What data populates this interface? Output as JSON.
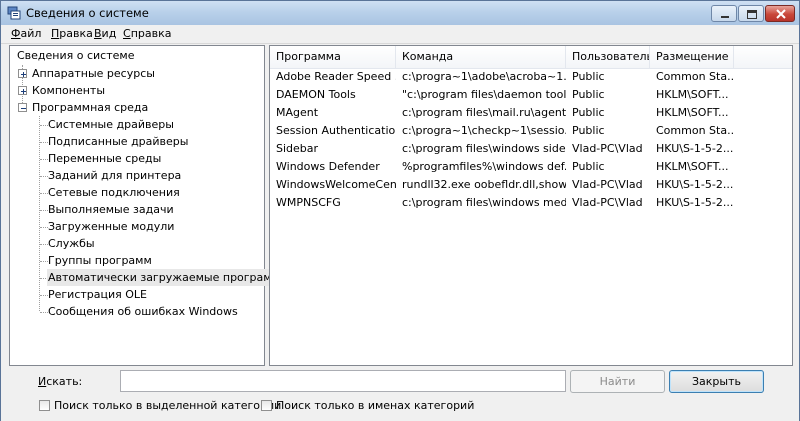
{
  "window": {
    "title": "Сведения о системе"
  },
  "menu": [
    "Файл",
    "Правка",
    "Вид",
    "Справка"
  ],
  "tree": {
    "root": "Сведения о системе",
    "nodes": [
      {
        "label": "Аппаратные ресурсы",
        "expander": "+"
      },
      {
        "label": "Компоненты",
        "expander": "+"
      },
      {
        "label": "Программная среда",
        "expander": "−"
      }
    ],
    "software_children": [
      "Системные драйверы",
      "Подписанные драйверы",
      "Переменные среды",
      "Заданий для принтера",
      "Сетевые подключения",
      "Выполняемые задачи",
      "Загруженные модули",
      "Службы",
      "Группы программ",
      "Автоматически загружаемые программы",
      "Регистрация OLE",
      "Сообщения об ошибках Windows"
    ],
    "selected": "Автоматически загружаемые программы"
  },
  "table": {
    "columns": [
      "Программа",
      "Команда",
      "Пользователь",
      "Размещение"
    ],
    "rows": [
      [
        "Adobe Reader Speed ...",
        "c:\\progra~1\\adobe\\acroba~1....",
        "Public",
        "Common Sta..."
      ],
      [
        "DAEMON Tools",
        "\"c:\\program files\\daemon tool...",
        "Public",
        "HKLM\\SOFT..."
      ],
      [
        "MAgent",
        "c:\\program files\\mail.ru\\agent...",
        "Public",
        "HKLM\\SOFT..."
      ],
      [
        "Session Authentication...",
        "c:\\progra~1\\checkp~1\\sessio...",
        "Public",
        "Common Sta..."
      ],
      [
        "Sidebar",
        "c:\\program files\\windows side...",
        "Vlad-PC\\Vlad",
        "HKU\\S-1-5-2..."
      ],
      [
        "Windows Defender",
        "%programfiles%\\windows def...",
        "Public",
        "HKLM\\SOFT..."
      ],
      [
        "WindowsWelcomeCent...",
        "rundll32.exe oobefldr.dll,show...",
        "Vlad-PC\\Vlad",
        "HKU\\S-1-5-2..."
      ],
      [
        "WMPNSCFG",
        "c:\\program files\\windows med...",
        "Vlad-PC\\Vlad",
        "HKU\\S-1-5-2..."
      ]
    ]
  },
  "search": {
    "label": "Искать:",
    "value": "",
    "find_button": "Найти",
    "close_button": "Закрыть",
    "option_selected_category": "Поиск только в выделенной категории",
    "option_category_names": "Поиск только в именах категорий"
  }
}
